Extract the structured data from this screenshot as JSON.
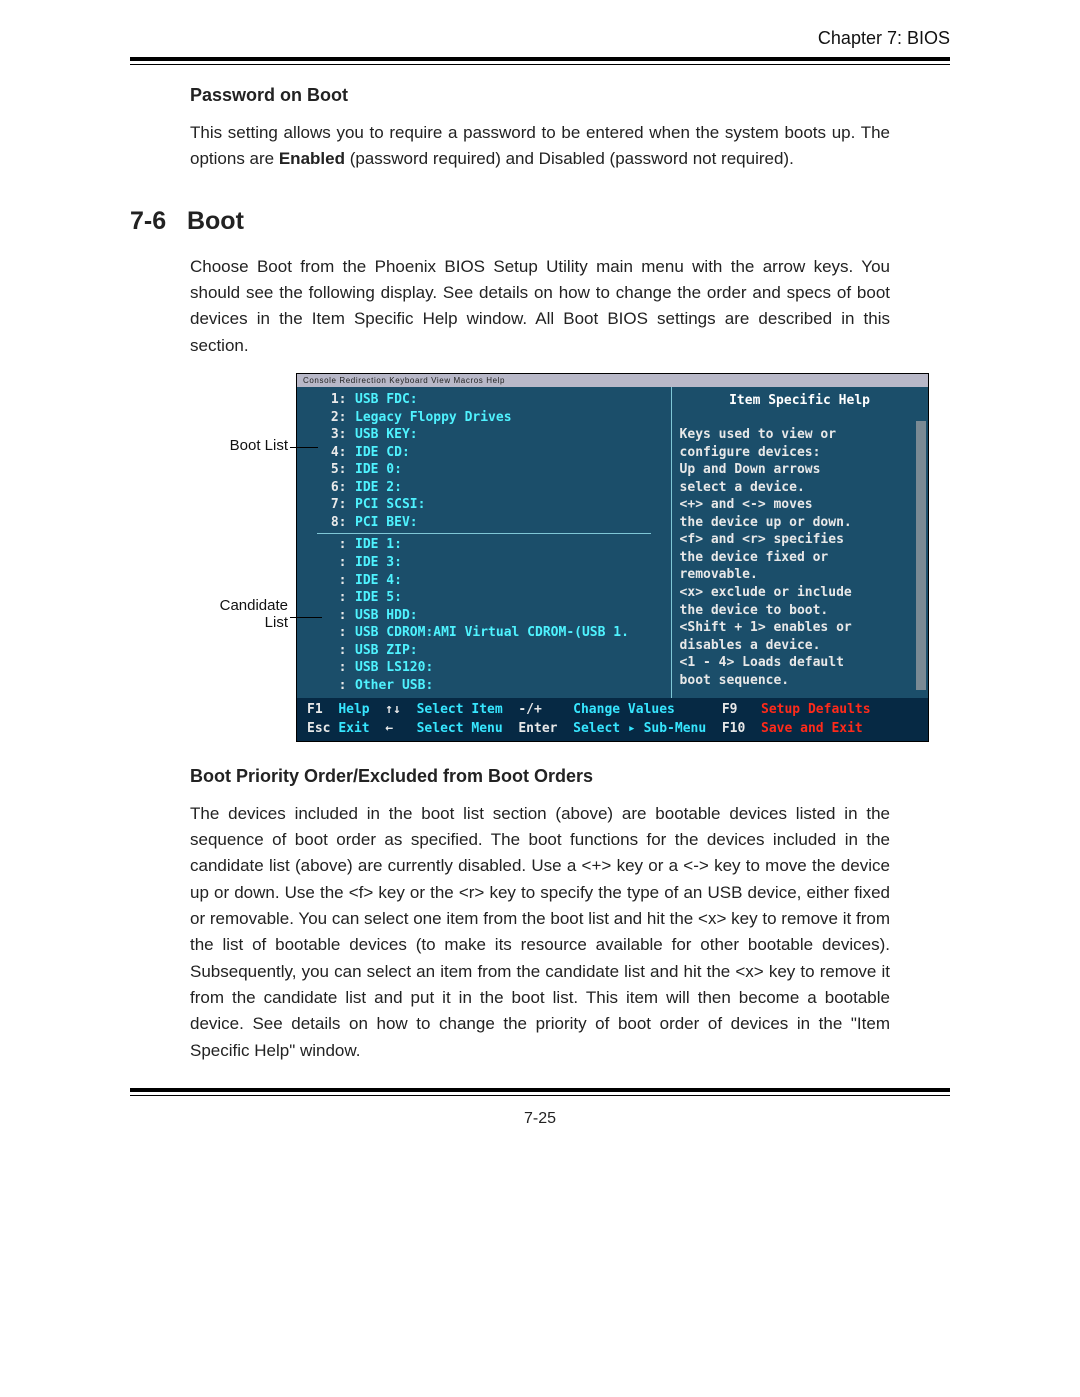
{
  "header": {
    "chapter_label": "Chapter 7: BIOS"
  },
  "password_section": {
    "title": "Password on Boot",
    "text_pre": "This setting allows you to require a password to be entered when the system boots up.  The options are ",
    "text_bold": "Enabled",
    "text_post": " (password required) and Disabled (password not required)."
  },
  "boot_section": {
    "number": "7-6",
    "title": "Boot",
    "intro": "Choose Boot from the Phoenix BIOS Setup Utility main menu with the arrow keys.  You should see the following display.  See details on how to change the order and specs of boot devices in the Item Specific Help window.  All Boot BIOS settings are described in this section."
  },
  "callouts": {
    "boot_list": "Boot List",
    "candidate_list": "Candidate\nList"
  },
  "bios": {
    "window_menu": [
      "Console Redirection",
      "Keyboard",
      "View",
      "Macros",
      "Help"
    ],
    "help_title": "Item Specific Help",
    "boot_list": [
      {
        "n": "1:",
        "dev": "USB FDC:"
      },
      {
        "n": "2:",
        "dev": "Legacy Floppy Drives"
      },
      {
        "n": "3:",
        "dev": "USB KEY:"
      },
      {
        "n": "4:",
        "dev": "IDE CD:"
      },
      {
        "n": "5:",
        "dev": "IDE 0:"
      },
      {
        "n": "6:",
        "dev": "IDE 2:"
      },
      {
        "n": "7:",
        "dev": "PCI SCSI:"
      },
      {
        "n": "8:",
        "dev": "PCI BEV:"
      }
    ],
    "candidate_list": [
      {
        "n": ":",
        "dev": "IDE 1:"
      },
      {
        "n": ":",
        "dev": "IDE 3:"
      },
      {
        "n": ":",
        "dev": "IDE 4:"
      },
      {
        "n": ":",
        "dev": "IDE 5:"
      },
      {
        "n": ":",
        "dev": "USB HDD:"
      },
      {
        "n": ":",
        "dev": "USB CDROM:AMI Virtual CDROM-(USB 1."
      },
      {
        "n": ":",
        "dev": "USB ZIP:"
      },
      {
        "n": ":",
        "dev": "USB LS120:"
      },
      {
        "n": ":",
        "dev": "Other USB:"
      }
    ],
    "help_lines": [
      "Keys used to view or",
      "configure devices:",
      "Up and Down arrows",
      "select a device.",
      "<+> and <-> moves",
      "the device up or down.",
      "<f> and <r> specifies",
      "the device fixed or",
      "removable.",
      "<x> exclude or include",
      "the device to boot.",
      "<Shift + 1> enables or",
      "disables a device.",
      "<1 - 4> Loads default",
      "boot sequence."
    ],
    "keybar": {
      "row1": [
        {
          "key": "F1",
          "label": "Help"
        },
        {
          "key": "↑↓",
          "label": "Select Item"
        },
        {
          "key": "-/+",
          "label": "Change Values"
        },
        {
          "key": "F9",
          "label": "Setup Defaults",
          "red": true
        }
      ],
      "row2": [
        {
          "key": "Esc",
          "label": "Exit"
        },
        {
          "key": "←",
          "label": "Select Menu"
        },
        {
          "key": "Enter",
          "label": "Select ▸ Sub-Menu"
        },
        {
          "key": "F10",
          "label": "Save and Exit",
          "red": true
        }
      ]
    }
  },
  "priority_section": {
    "title": "Boot Priority Order/Excluded from Boot Orders",
    "para": "The devices included in the boot list section (above) are bootable devices listed in the sequence of boot order as specified. The boot functions for the devices included in the candidate list (above) are currently disabled.  Use a <+> key or a <-> key to move the device up or down. Use the <f> key or the <r> key to specify the type of an USB device, either fixed or removable. You can select one item from the boot list and hit the <x> key to remove it from the list of bootable devices (to make its resource available for other bootable devices). Subsequently, you can select an item from the candidate list and hit the <x> key  to remove it from the candidate list and put it in the boot list. This item will then become a bootable device. See details on how to change the priority of boot order of devices in the \"Item Specific Help\" window."
  },
  "footer": {
    "page_number": "7-25"
  }
}
